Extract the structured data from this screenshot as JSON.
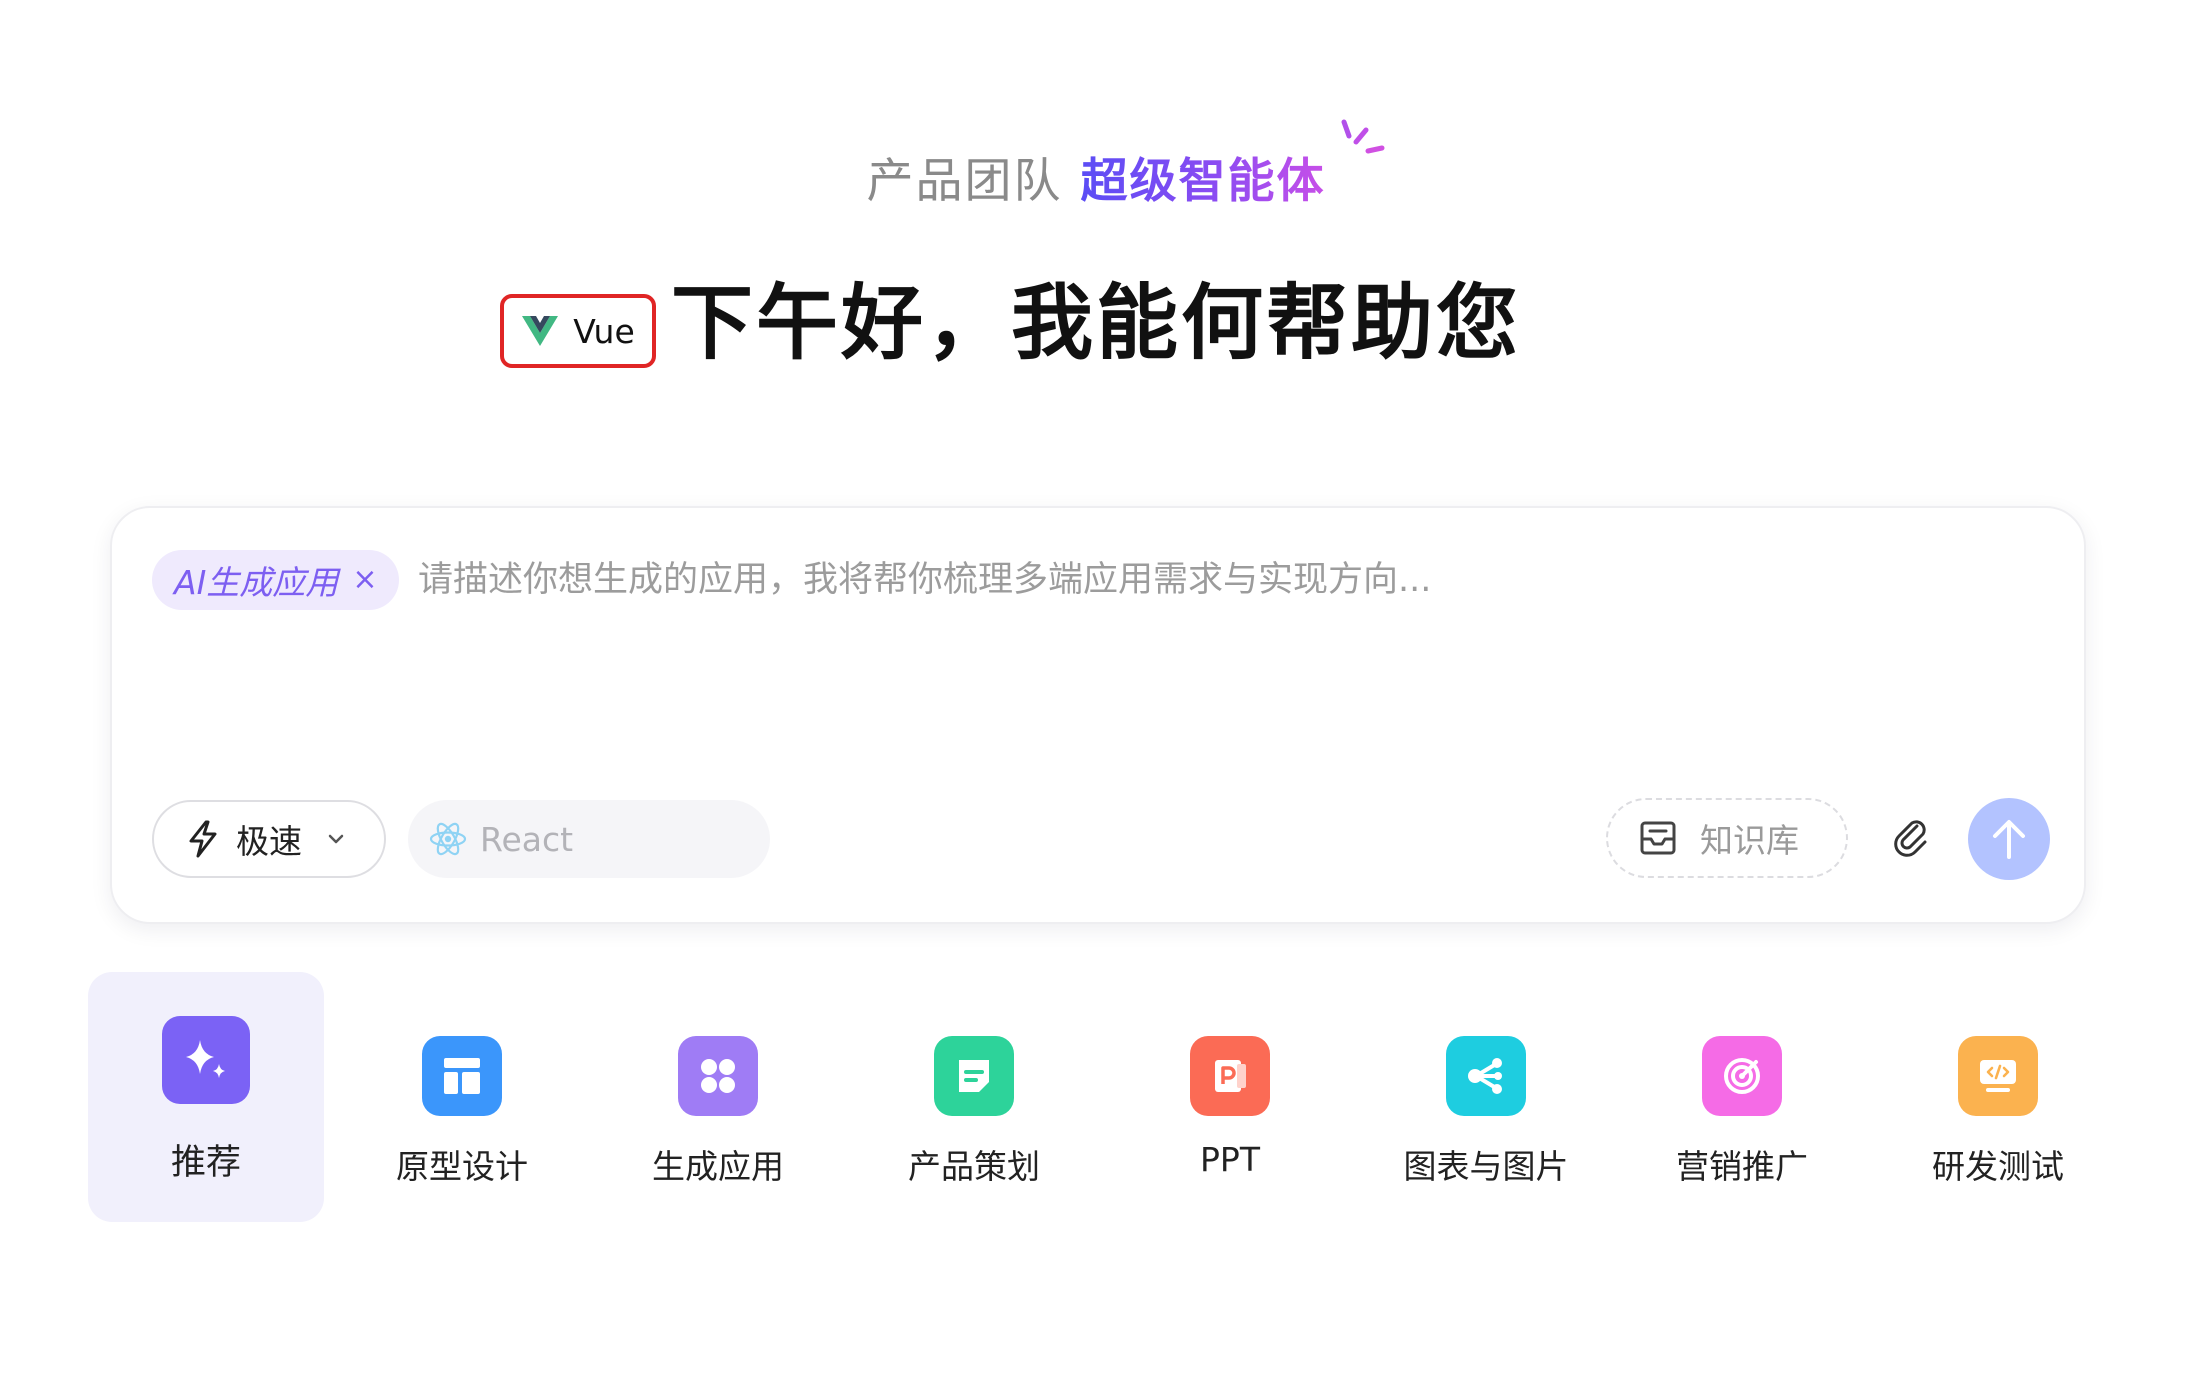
{
  "header": {
    "team_label": "产品团队",
    "super_label": "超级智能体",
    "greeting": "下午好，我能何帮助您"
  },
  "composer": {
    "mode_chip": "AI生成应用",
    "mode_chip_close": "×",
    "placeholder": "请描述你想生成的应用，我将帮你梳理多端应用需求与实现方向...",
    "speed_label": "极速",
    "frameworks": {
      "react_label": "React",
      "vue_label": "Vue",
      "selected": "Vue"
    },
    "knowledge_base_label": "知识库"
  },
  "categories": [
    {
      "label": "推荐",
      "icon": "sparkle-icon",
      "color": "#7b62f5",
      "active": true
    },
    {
      "label": "原型设计",
      "icon": "layout-icon",
      "color": "#3b96fb",
      "active": false
    },
    {
      "label": "生成应用",
      "icon": "apps-grid-icon",
      "color": "#9f7cf5",
      "active": false
    },
    {
      "label": "产品策划",
      "icon": "document-icon",
      "color": "#2dd39a",
      "active": false
    },
    {
      "label": "PPT",
      "icon": "ppt-icon",
      "color": "#fb6b55",
      "active": false
    },
    {
      "label": "图表与图片",
      "icon": "share-nodes-icon",
      "color": "#1ecde0",
      "active": false
    },
    {
      "label": "营销推广",
      "icon": "target-icon",
      "color": "#f56be6",
      "active": false
    },
    {
      "label": "研发测试",
      "icon": "code-screen-icon",
      "color": "#fbb24f",
      "active": false
    }
  ],
  "colors": {
    "accent": "#7d5ff1",
    "send_button": "#b3c3ff",
    "highlight_border": "#e02525",
    "vue_green": "#41b883",
    "vue_dark": "#35495e",
    "react_blue": "#8fd3f4"
  }
}
